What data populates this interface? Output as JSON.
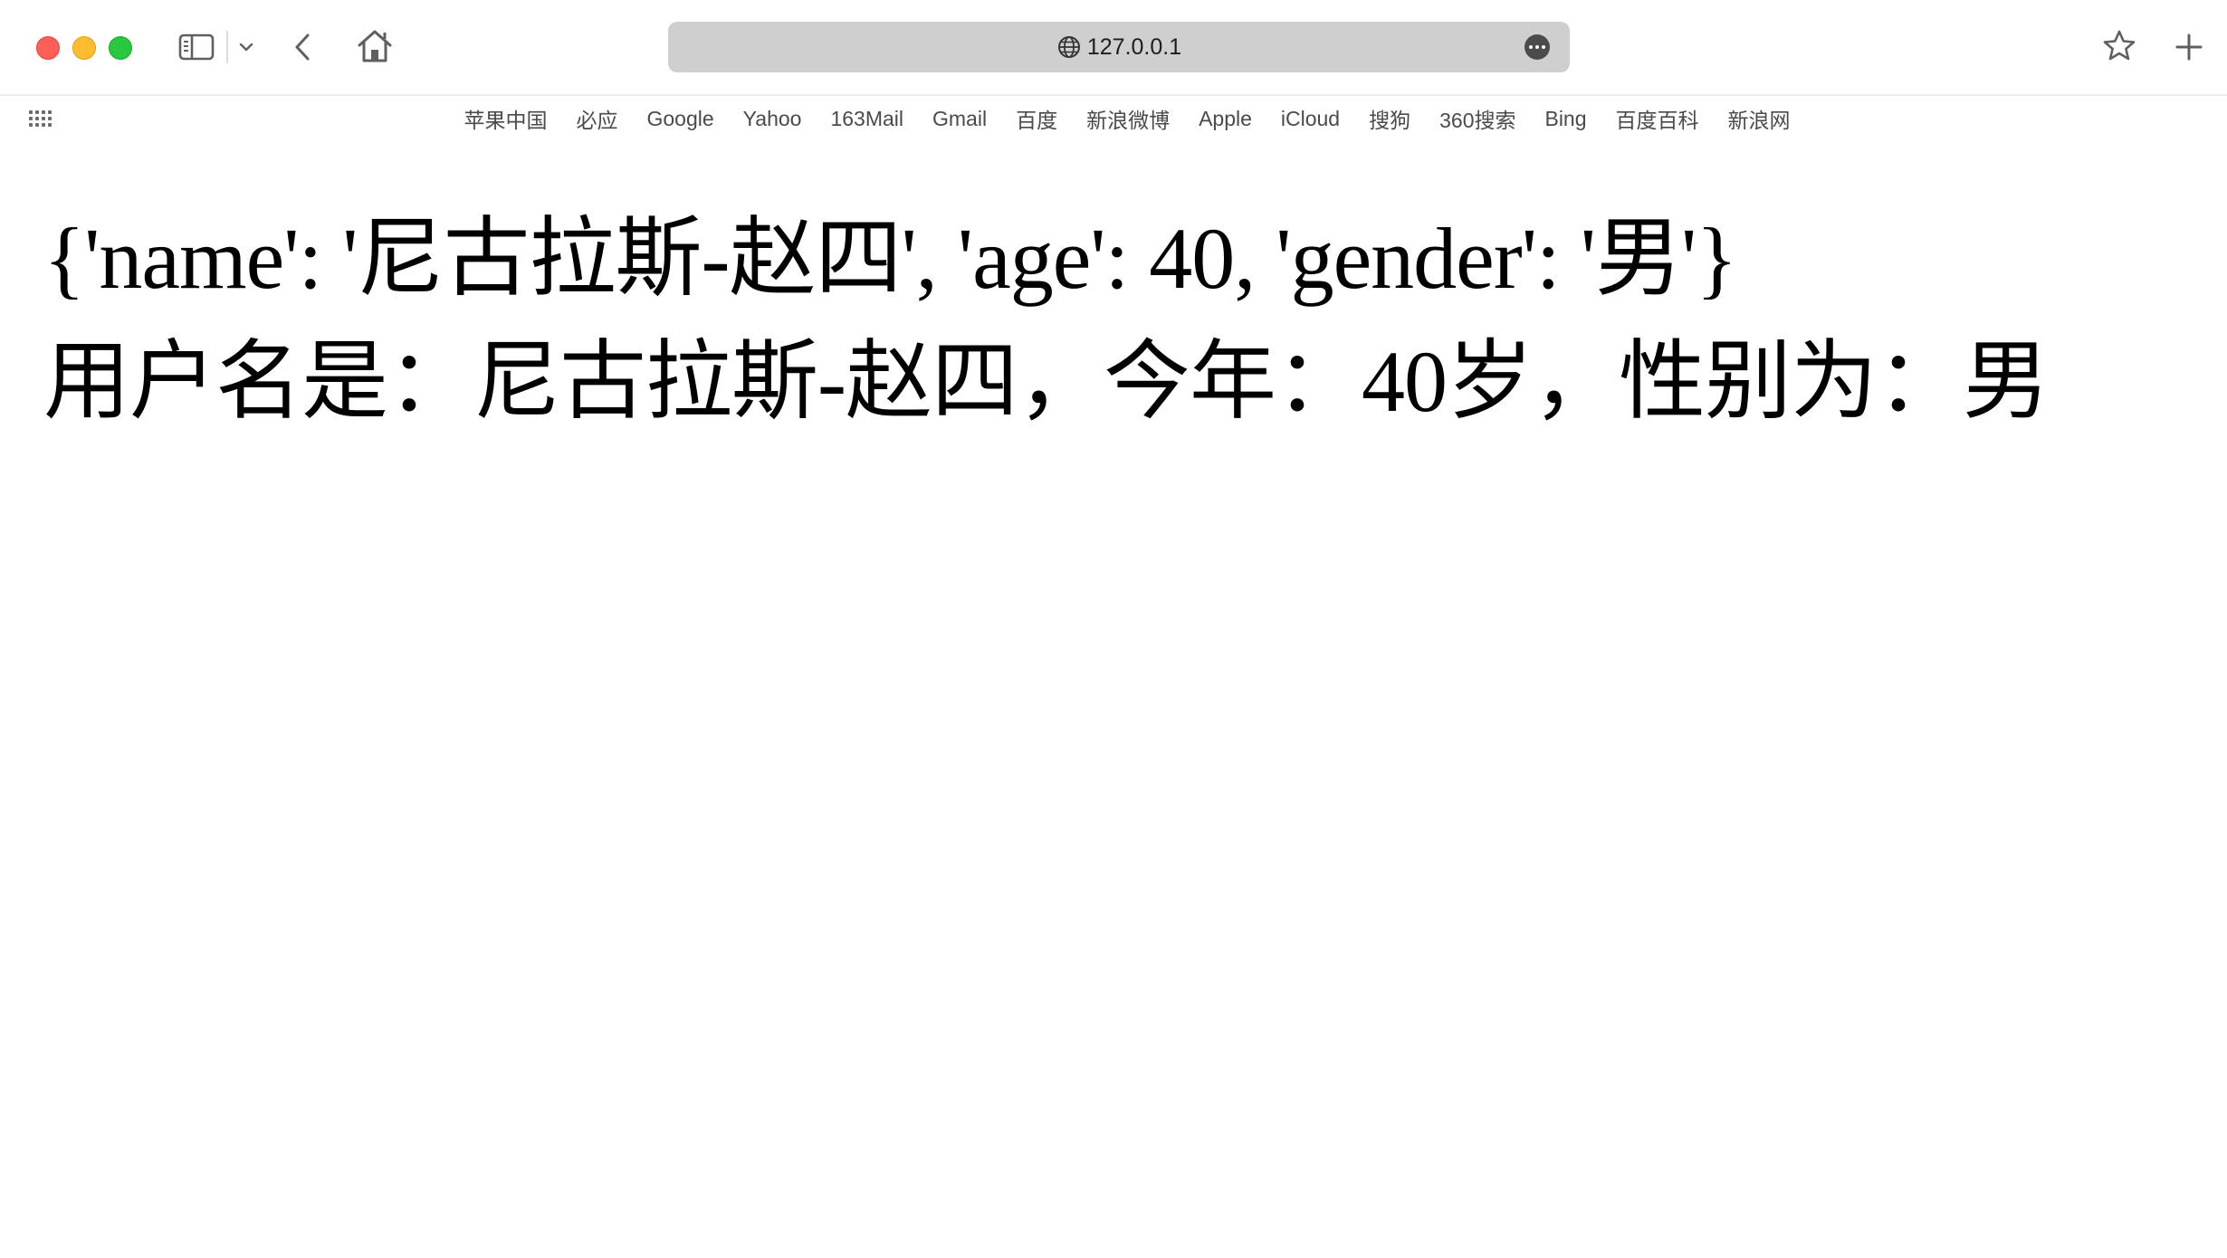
{
  "browser": {
    "url": "127.0.0.1",
    "bookmarks": [
      "苹果中国",
      "必应",
      "Google",
      "Yahoo",
      "163Mail",
      "Gmail",
      "百度",
      "新浪微博",
      "Apple",
      "iCloud",
      "搜狗",
      "360搜索",
      "Bing",
      "百度百科",
      "新浪网"
    ]
  },
  "page": {
    "dict_line": "{'name': '尼古拉斯-赵四', 'age': 40, 'gender': '男'}",
    "sentence_line": "用户名是：尼古拉斯-赵四，今年：40岁，性别为：男"
  }
}
